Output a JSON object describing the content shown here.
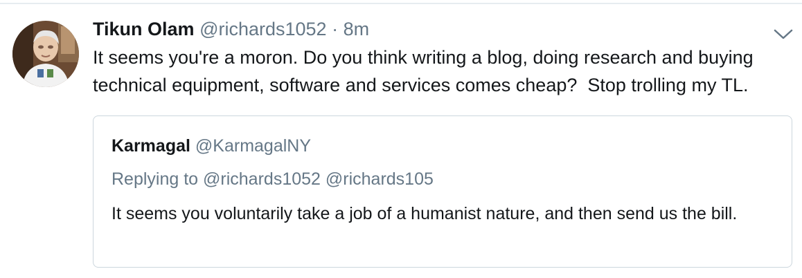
{
  "tweet": {
    "fullname": "Tikun Olam",
    "username": "@richards1052",
    "separator": "·",
    "timestamp": "8m",
    "text": "It seems you're a moron. Do you think writing a blog, doing research and buying technical equipment, software and services comes cheap?  Stop trolling my TL.",
    "menu_icon": "chevron-down-icon"
  },
  "quoted_tweet": {
    "fullname": "Karmagal",
    "username": "@KarmagalNY",
    "replying_to": "Replying to @richards1052 @richards105",
    "text": "It seems you voluntarily take a job of a humanist nature, and then send us the bill."
  },
  "colors": {
    "primary_text": "#14171a",
    "secondary_text": "#657786",
    "border": "#ccd6dd",
    "divider": "#e6ecf0"
  }
}
